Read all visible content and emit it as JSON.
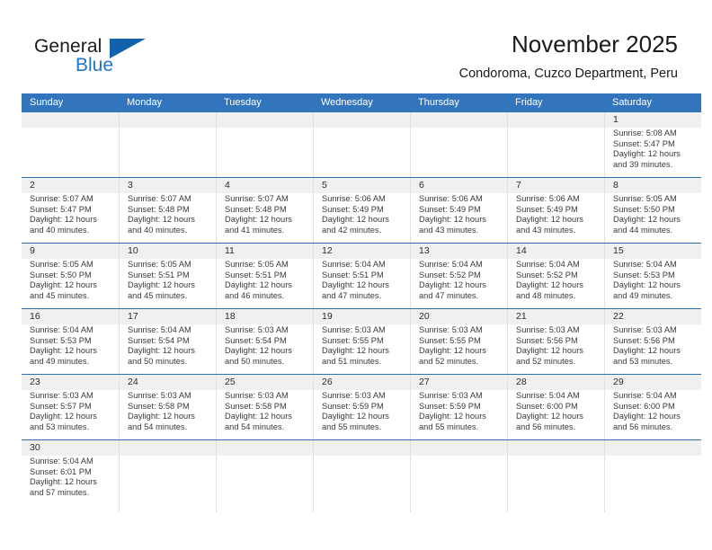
{
  "brand": {
    "name_dark": "General",
    "name_blue": "Blue",
    "accent_color": "#1161ab",
    "blue_text_color": "#1e76c4"
  },
  "header": {
    "title": "November 2025",
    "subtitle": "Condoroma, Cuzco Department, Peru"
  },
  "calendar": {
    "header_bg": "#3275bc",
    "band_bg": "#f0f0f0",
    "day_names": [
      "Sunday",
      "Monday",
      "Tuesday",
      "Wednesday",
      "Thursday",
      "Friday",
      "Saturday"
    ],
    "weeks": [
      [
        {
          "day": "",
          "sunrise": "",
          "sunset": "",
          "daylight_line1": "",
          "daylight_line2": ""
        },
        {
          "day": "",
          "sunrise": "",
          "sunset": "",
          "daylight_line1": "",
          "daylight_line2": ""
        },
        {
          "day": "",
          "sunrise": "",
          "sunset": "",
          "daylight_line1": "",
          "daylight_line2": ""
        },
        {
          "day": "",
          "sunrise": "",
          "sunset": "",
          "daylight_line1": "",
          "daylight_line2": ""
        },
        {
          "day": "",
          "sunrise": "",
          "sunset": "",
          "daylight_line1": "",
          "daylight_line2": ""
        },
        {
          "day": "",
          "sunrise": "",
          "sunset": "",
          "daylight_line1": "",
          "daylight_line2": ""
        },
        {
          "day": "1",
          "sunrise": "Sunrise: 5:08 AM",
          "sunset": "Sunset: 5:47 PM",
          "daylight_line1": "Daylight: 12 hours",
          "daylight_line2": "and 39 minutes."
        }
      ],
      [
        {
          "day": "2",
          "sunrise": "Sunrise: 5:07 AM",
          "sunset": "Sunset: 5:47 PM",
          "daylight_line1": "Daylight: 12 hours",
          "daylight_line2": "and 40 minutes."
        },
        {
          "day": "3",
          "sunrise": "Sunrise: 5:07 AM",
          "sunset": "Sunset: 5:48 PM",
          "daylight_line1": "Daylight: 12 hours",
          "daylight_line2": "and 40 minutes."
        },
        {
          "day": "4",
          "sunrise": "Sunrise: 5:07 AM",
          "sunset": "Sunset: 5:48 PM",
          "daylight_line1": "Daylight: 12 hours",
          "daylight_line2": "and 41 minutes."
        },
        {
          "day": "5",
          "sunrise": "Sunrise: 5:06 AM",
          "sunset": "Sunset: 5:49 PM",
          "daylight_line1": "Daylight: 12 hours",
          "daylight_line2": "and 42 minutes."
        },
        {
          "day": "6",
          "sunrise": "Sunrise: 5:06 AM",
          "sunset": "Sunset: 5:49 PM",
          "daylight_line1": "Daylight: 12 hours",
          "daylight_line2": "and 43 minutes."
        },
        {
          "day": "7",
          "sunrise": "Sunrise: 5:06 AM",
          "sunset": "Sunset: 5:49 PM",
          "daylight_line1": "Daylight: 12 hours",
          "daylight_line2": "and 43 minutes."
        },
        {
          "day": "8",
          "sunrise": "Sunrise: 5:05 AM",
          "sunset": "Sunset: 5:50 PM",
          "daylight_line1": "Daylight: 12 hours",
          "daylight_line2": "and 44 minutes."
        }
      ],
      [
        {
          "day": "9",
          "sunrise": "Sunrise: 5:05 AM",
          "sunset": "Sunset: 5:50 PM",
          "daylight_line1": "Daylight: 12 hours",
          "daylight_line2": "and 45 minutes."
        },
        {
          "day": "10",
          "sunrise": "Sunrise: 5:05 AM",
          "sunset": "Sunset: 5:51 PM",
          "daylight_line1": "Daylight: 12 hours",
          "daylight_line2": "and 45 minutes."
        },
        {
          "day": "11",
          "sunrise": "Sunrise: 5:05 AM",
          "sunset": "Sunset: 5:51 PM",
          "daylight_line1": "Daylight: 12 hours",
          "daylight_line2": "and 46 minutes."
        },
        {
          "day": "12",
          "sunrise": "Sunrise: 5:04 AM",
          "sunset": "Sunset: 5:51 PM",
          "daylight_line1": "Daylight: 12 hours",
          "daylight_line2": "and 47 minutes."
        },
        {
          "day": "13",
          "sunrise": "Sunrise: 5:04 AM",
          "sunset": "Sunset: 5:52 PM",
          "daylight_line1": "Daylight: 12 hours",
          "daylight_line2": "and 47 minutes."
        },
        {
          "day": "14",
          "sunrise": "Sunrise: 5:04 AM",
          "sunset": "Sunset: 5:52 PM",
          "daylight_line1": "Daylight: 12 hours",
          "daylight_line2": "and 48 minutes."
        },
        {
          "day": "15",
          "sunrise": "Sunrise: 5:04 AM",
          "sunset": "Sunset: 5:53 PM",
          "daylight_line1": "Daylight: 12 hours",
          "daylight_line2": "and 49 minutes."
        }
      ],
      [
        {
          "day": "16",
          "sunrise": "Sunrise: 5:04 AM",
          "sunset": "Sunset: 5:53 PM",
          "daylight_line1": "Daylight: 12 hours",
          "daylight_line2": "and 49 minutes."
        },
        {
          "day": "17",
          "sunrise": "Sunrise: 5:04 AM",
          "sunset": "Sunset: 5:54 PM",
          "daylight_line1": "Daylight: 12 hours",
          "daylight_line2": "and 50 minutes."
        },
        {
          "day": "18",
          "sunrise": "Sunrise: 5:03 AM",
          "sunset": "Sunset: 5:54 PM",
          "daylight_line1": "Daylight: 12 hours",
          "daylight_line2": "and 50 minutes."
        },
        {
          "day": "19",
          "sunrise": "Sunrise: 5:03 AM",
          "sunset": "Sunset: 5:55 PM",
          "daylight_line1": "Daylight: 12 hours",
          "daylight_line2": "and 51 minutes."
        },
        {
          "day": "20",
          "sunrise": "Sunrise: 5:03 AM",
          "sunset": "Sunset: 5:55 PM",
          "daylight_line1": "Daylight: 12 hours",
          "daylight_line2": "and 52 minutes."
        },
        {
          "day": "21",
          "sunrise": "Sunrise: 5:03 AM",
          "sunset": "Sunset: 5:56 PM",
          "daylight_line1": "Daylight: 12 hours",
          "daylight_line2": "and 52 minutes."
        },
        {
          "day": "22",
          "sunrise": "Sunrise: 5:03 AM",
          "sunset": "Sunset: 5:56 PM",
          "daylight_line1": "Daylight: 12 hours",
          "daylight_line2": "and 53 minutes."
        }
      ],
      [
        {
          "day": "23",
          "sunrise": "Sunrise: 5:03 AM",
          "sunset": "Sunset: 5:57 PM",
          "daylight_line1": "Daylight: 12 hours",
          "daylight_line2": "and 53 minutes."
        },
        {
          "day": "24",
          "sunrise": "Sunrise: 5:03 AM",
          "sunset": "Sunset: 5:58 PM",
          "daylight_line1": "Daylight: 12 hours",
          "daylight_line2": "and 54 minutes."
        },
        {
          "day": "25",
          "sunrise": "Sunrise: 5:03 AM",
          "sunset": "Sunset: 5:58 PM",
          "daylight_line1": "Daylight: 12 hours",
          "daylight_line2": "and 54 minutes."
        },
        {
          "day": "26",
          "sunrise": "Sunrise: 5:03 AM",
          "sunset": "Sunset: 5:59 PM",
          "daylight_line1": "Daylight: 12 hours",
          "daylight_line2": "and 55 minutes."
        },
        {
          "day": "27",
          "sunrise": "Sunrise: 5:03 AM",
          "sunset": "Sunset: 5:59 PM",
          "daylight_line1": "Daylight: 12 hours",
          "daylight_line2": "and 55 minutes."
        },
        {
          "day": "28",
          "sunrise": "Sunrise: 5:04 AM",
          "sunset": "Sunset: 6:00 PM",
          "daylight_line1": "Daylight: 12 hours",
          "daylight_line2": "and 56 minutes."
        },
        {
          "day": "29",
          "sunrise": "Sunrise: 5:04 AM",
          "sunset": "Sunset: 6:00 PM",
          "daylight_line1": "Daylight: 12 hours",
          "daylight_line2": "and 56 minutes."
        }
      ],
      [
        {
          "day": "30",
          "sunrise": "Sunrise: 5:04 AM",
          "sunset": "Sunset: 6:01 PM",
          "daylight_line1": "Daylight: 12 hours",
          "daylight_line2": "and 57 minutes."
        },
        {
          "day": "",
          "sunrise": "",
          "sunset": "",
          "daylight_line1": "",
          "daylight_line2": ""
        },
        {
          "day": "",
          "sunrise": "",
          "sunset": "",
          "daylight_line1": "",
          "daylight_line2": ""
        },
        {
          "day": "",
          "sunrise": "",
          "sunset": "",
          "daylight_line1": "",
          "daylight_line2": ""
        },
        {
          "day": "",
          "sunrise": "",
          "sunset": "",
          "daylight_line1": "",
          "daylight_line2": ""
        },
        {
          "day": "",
          "sunrise": "",
          "sunset": "",
          "daylight_line1": "",
          "daylight_line2": ""
        },
        {
          "day": "",
          "sunrise": "",
          "sunset": "",
          "daylight_line1": "",
          "daylight_line2": ""
        }
      ]
    ]
  }
}
